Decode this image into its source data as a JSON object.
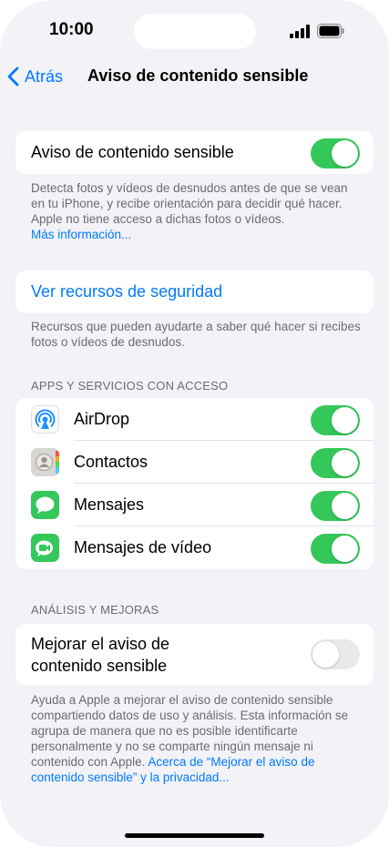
{
  "status": {
    "time": "10:00"
  },
  "nav": {
    "back_label": "Atrás",
    "title": "Aviso de contenido sensible"
  },
  "warning": {
    "label": "Aviso de contenido sensible",
    "enabled": true,
    "footnote": "Detecta fotos y vídeos de desnudos antes de que se vean en tu iPhone, y recibe orientación para decidir qué hacer. Apple no tiene acceso a dichas fotos o vídeos.",
    "more_info": "Más información..."
  },
  "resources": {
    "label": "Ver recursos de seguridad",
    "footnote": "Recursos que pueden ayudarte a saber qué hacer si recibes fotos o vídeos de desnudos."
  },
  "apps": {
    "header": "APPS Y SERVICIOS CON ACCESO",
    "items": [
      {
        "label": "AirDrop",
        "icon": "airdrop-icon",
        "enabled": true
      },
      {
        "label": "Contactos",
        "icon": "contacts-icon",
        "enabled": true
      },
      {
        "label": "Mensajes",
        "icon": "messages-icon",
        "enabled": true
      },
      {
        "label": "Mensajes de vídeo",
        "icon": "facetime-icon",
        "enabled": true
      }
    ]
  },
  "analytics": {
    "header": "ANÁLISIS Y MEJORAS",
    "label_line1": "Mejorar el aviso de",
    "label_line2": "contenido sensible",
    "enabled": false,
    "footnote": "Ayuda a Apple a mejorar el aviso de contenido sensible compartiendo datos de uso y análisis. Esta información se agrupa de manera que no es posible identificarte personalmente y no se comparte ningún mensaje ni contenido con Apple.",
    "link": "Acerca de “Mejorar el aviso de contenido sensible” y la privacidad..."
  },
  "colors": {
    "accent": "#007aff",
    "toggle_on": "#34c759",
    "toggle_off": "#e9e9eb"
  }
}
